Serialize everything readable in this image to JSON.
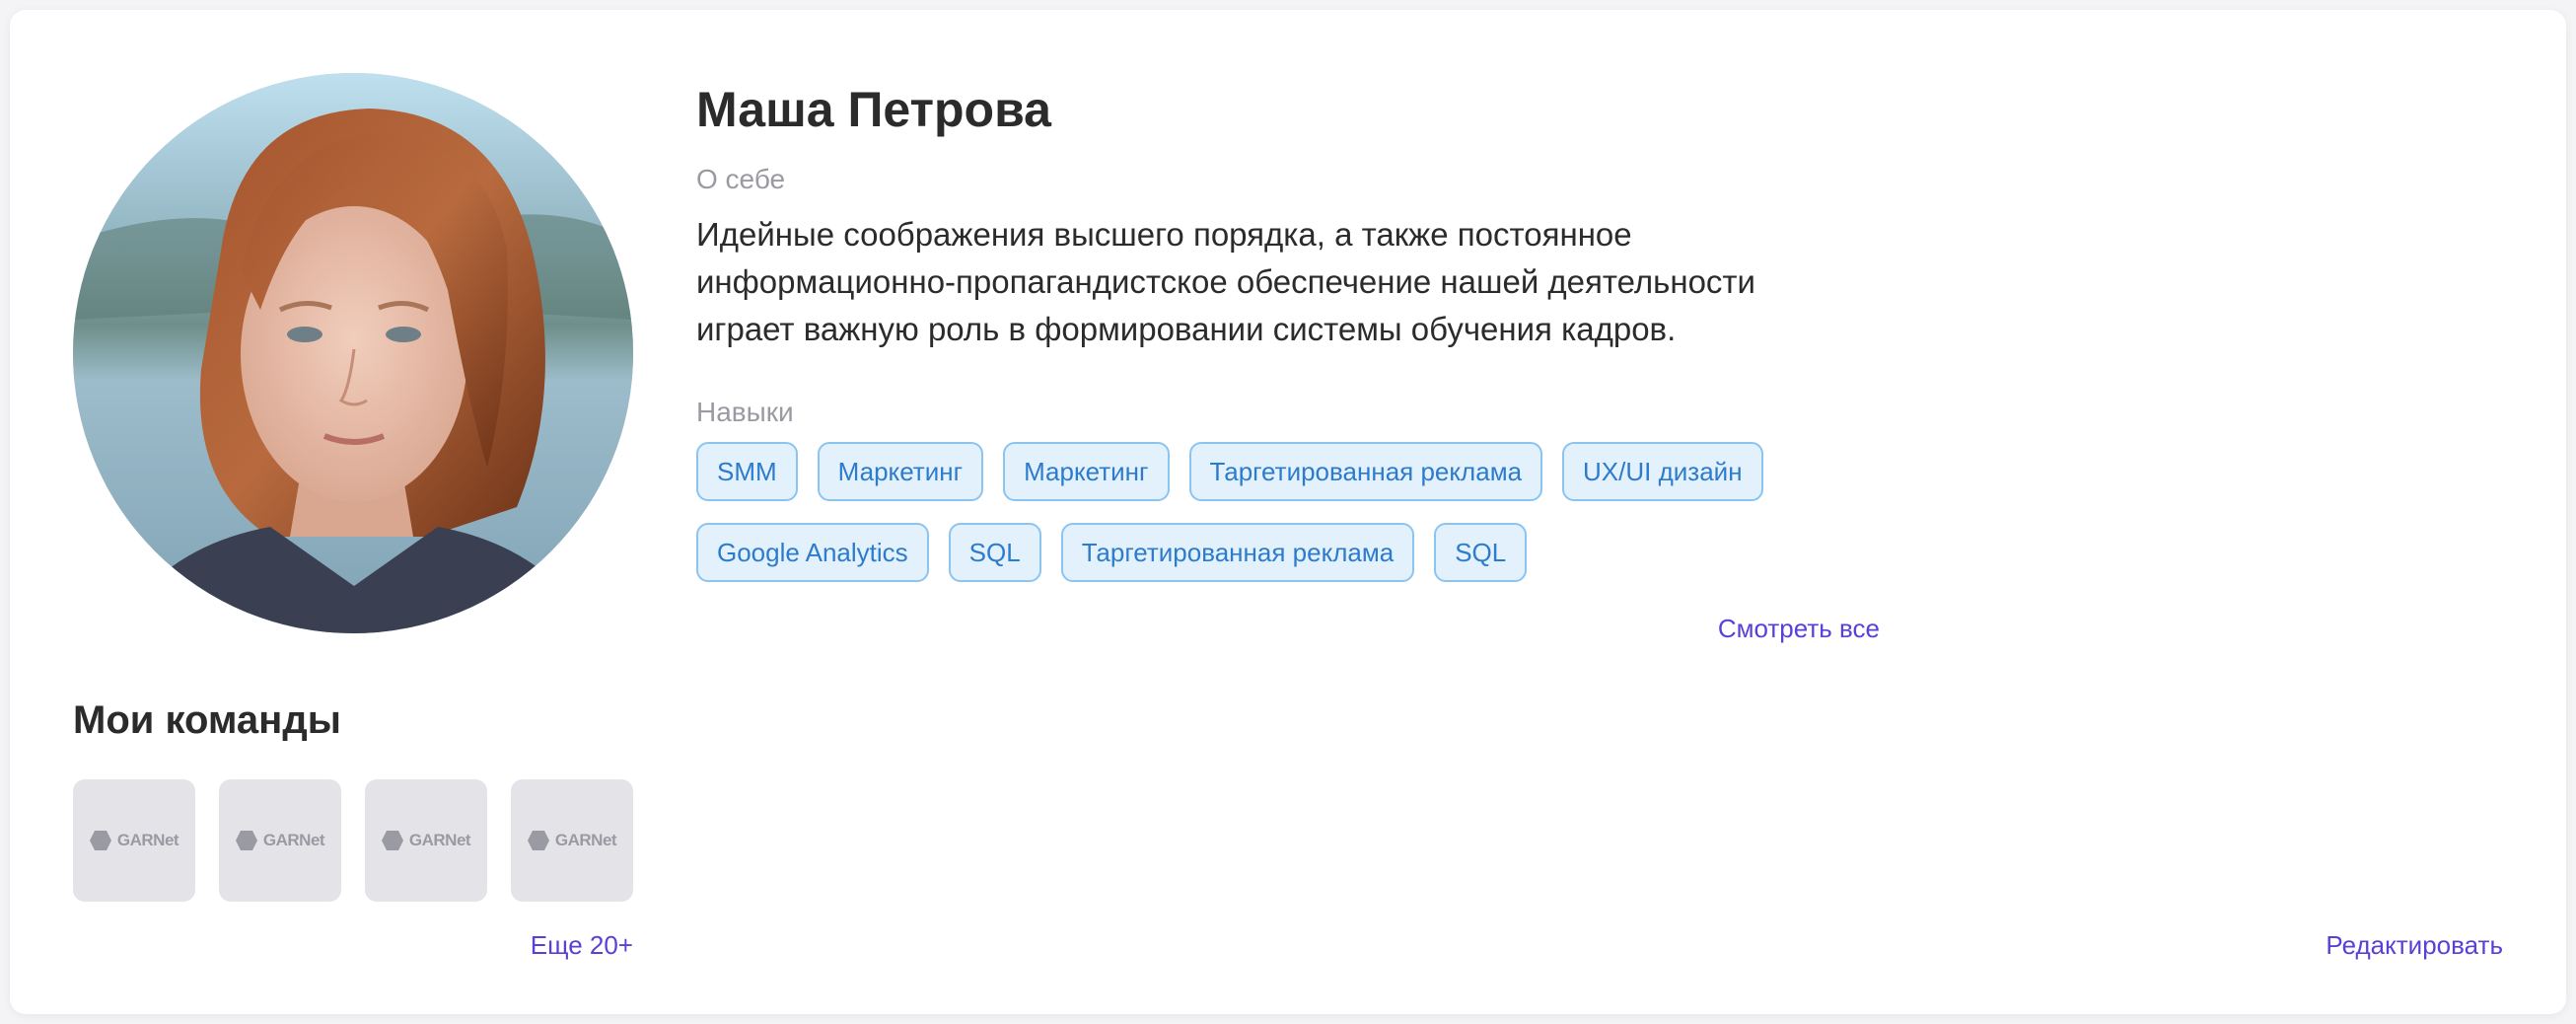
{
  "profile": {
    "name": "Маша Петрова",
    "about_label": "О себе",
    "about_text": "Идейные соображения высшего порядка, а также постоянное информационно-пропагандистское обеспечение нашей деятельности играет важную роль в формировании системы обучения кадров.",
    "skills_label": "Навыки",
    "skills": [
      "SMM",
      "Маркетинг",
      "Маркетинг",
      "Таргетированная реклама",
      "UX/UI дизайн",
      "Google Analytics",
      "SQL",
      "Таргетированная реклама",
      "SQL"
    ],
    "see_all_label": "Смотреть все",
    "edit_label": "Редактировать"
  },
  "teams": {
    "title": "Мои команды",
    "items": [
      {
        "logo_text": "GARNet",
        "icon": "garnet-logo"
      },
      {
        "logo_text": "GARNet",
        "icon": "garnet-logo"
      },
      {
        "logo_text": "GARNet",
        "icon": "garnet-logo"
      },
      {
        "logo_text": "GARNet",
        "icon": "garnet-logo"
      }
    ],
    "more_label": "Еще 20+"
  },
  "colors": {
    "accent": "#5b3fd6",
    "chip_bg": "#e3f1fc",
    "chip_border": "#8cc4f0",
    "chip_text": "#2d7bcc",
    "muted": "#9a9aa2"
  }
}
